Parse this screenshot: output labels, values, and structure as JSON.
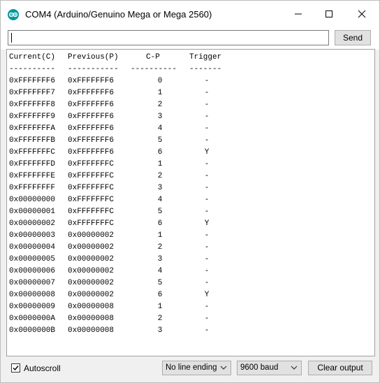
{
  "window": {
    "title": "COM4 (Arduino/Genuino Mega or Mega 2560)"
  },
  "input": {
    "value": "",
    "send_label": "Send"
  },
  "table": {
    "headers": [
      "Current(C)",
      "Previous(P)",
      "C-P",
      "Trigger"
    ],
    "separators": [
      "----------",
      "-----------",
      "----------",
      "-------"
    ],
    "rows": [
      [
        "0xFFFFFFF6",
        "0xFFFFFFF6",
        "0",
        "-"
      ],
      [
        "0xFFFFFFF7",
        "0xFFFFFFF6",
        "1",
        "-"
      ],
      [
        "0xFFFFFFF8",
        "0xFFFFFFF6",
        "2",
        "-"
      ],
      [
        "0xFFFFFFF9",
        "0xFFFFFFF6",
        "3",
        "-"
      ],
      [
        "0xFFFFFFFA",
        "0xFFFFFFF6",
        "4",
        "-"
      ],
      [
        "0xFFFFFFFB",
        "0xFFFFFFF6",
        "5",
        "-"
      ],
      [
        "0xFFFFFFFC",
        "0xFFFFFFF6",
        "6",
        "Y"
      ],
      [
        "0xFFFFFFFD",
        "0xFFFFFFFC",
        "1",
        "-"
      ],
      [
        "0xFFFFFFFE",
        "0xFFFFFFFC",
        "2",
        "-"
      ],
      [
        "0xFFFFFFFF",
        "0xFFFFFFFC",
        "3",
        "-"
      ],
      [
        "0x00000000",
        "0xFFFFFFFC",
        "4",
        "-"
      ],
      [
        "0x00000001",
        "0xFFFFFFFC",
        "5",
        "-"
      ],
      [
        "0x00000002",
        "0xFFFFFFFC",
        "6",
        "Y"
      ],
      [
        "0x00000003",
        "0x00000002",
        "1",
        "-"
      ],
      [
        "0x00000004",
        "0x00000002",
        "2",
        "-"
      ],
      [
        "0x00000005",
        "0x00000002",
        "3",
        "-"
      ],
      [
        "0x00000006",
        "0x00000002",
        "4",
        "-"
      ],
      [
        "0x00000007",
        "0x00000002",
        "5",
        "-"
      ],
      [
        "0x00000008",
        "0x00000002",
        "6",
        "Y"
      ],
      [
        "0x00000009",
        "0x00000008",
        "1",
        "-"
      ],
      [
        "0x0000000A",
        "0x00000008",
        "2",
        "-"
      ],
      [
        "0x0000000B",
        "0x00000008",
        "3",
        "-"
      ]
    ]
  },
  "footer": {
    "autoscroll_label": "Autoscroll",
    "autoscroll_checked": true,
    "line_ending": "No line ending",
    "baud": "9600 baud",
    "clear_label": "Clear output"
  },
  "icons": {
    "app": "arduino-logo-icon",
    "minimize": "minimize-icon",
    "maximize": "maximize-icon",
    "close": "close-icon",
    "check": "checkmark-icon",
    "dropdown": "chevron-down-icon"
  },
  "colors": {
    "accent": "#00979c"
  }
}
